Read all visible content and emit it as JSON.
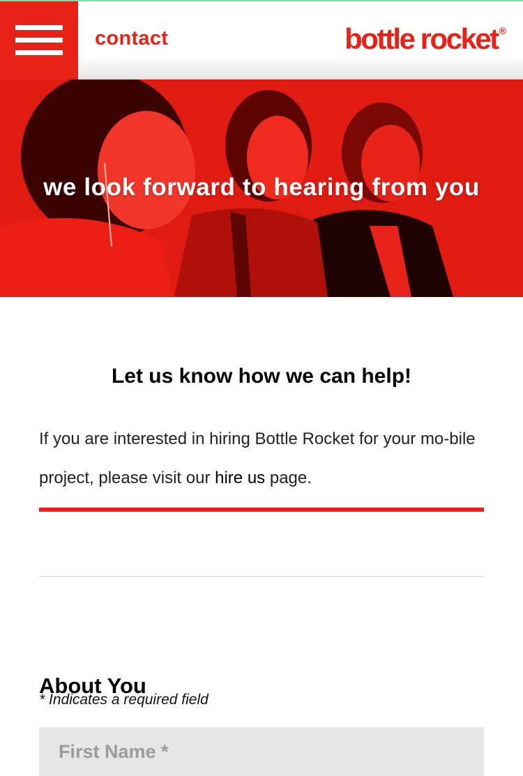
{
  "header": {
    "menu_icon": "hamburger-menu-icon",
    "page_label": "contact",
    "logo_text": "bottle rocket",
    "logo_mark": "®"
  },
  "hero": {
    "headline": "we look forward to hearing from you"
  },
  "main": {
    "heading": "Let us know how we can help!",
    "intro_before": "If you are interested in hiring Bottle Rocket for your mo-bile project, please visit our ",
    "intro_link": "hire us",
    "intro_after": " page."
  },
  "form": {
    "section_title": "About You",
    "required_note": "* Indicates a required field",
    "first_name_placeholder": "First Name *",
    "first_name_value": ""
  },
  "colors": {
    "brand_red": "#e82217",
    "field_bg": "#e6e6e6"
  }
}
